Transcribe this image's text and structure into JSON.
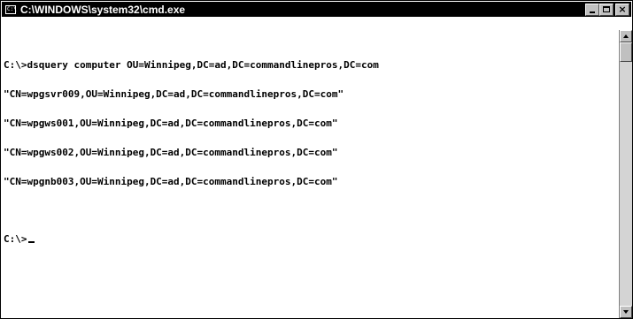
{
  "window": {
    "title": "C:\\WINDOWS\\system32\\cmd.exe",
    "icon": "cmd-icon",
    "icon_glyph": "C:\\",
    "controls": {
      "minimize_icon": "minimize-icon",
      "maximize_icon": "maximize-icon",
      "close_icon": "close-icon",
      "close_glyph": "×"
    }
  },
  "console": {
    "lines": [
      "C:\\>dsquery computer OU=Winnipeg,DC=ad,DC=commandlinepros,DC=com",
      "\"CN=wpgsvr009,OU=Winnipeg,DC=ad,DC=commandlinepros,DC=com\"",
      "\"CN=wpgws001,OU=Winnipeg,DC=ad,DC=commandlinepros,DC=com\"",
      "\"CN=wpgws002,OU=Winnipeg,DC=ad,DC=commandlinepros,DC=com\"",
      "\"CN=wpgnb003,OU=Winnipeg,DC=ad,DC=commandlinepros,DC=com\""
    ],
    "prompt": "C:\\>"
  },
  "colors": {
    "titlebar_bg": "#000000",
    "titlebar_text": "#ffffff",
    "console_bg": "#ffffff",
    "console_text": "#000000"
  }
}
